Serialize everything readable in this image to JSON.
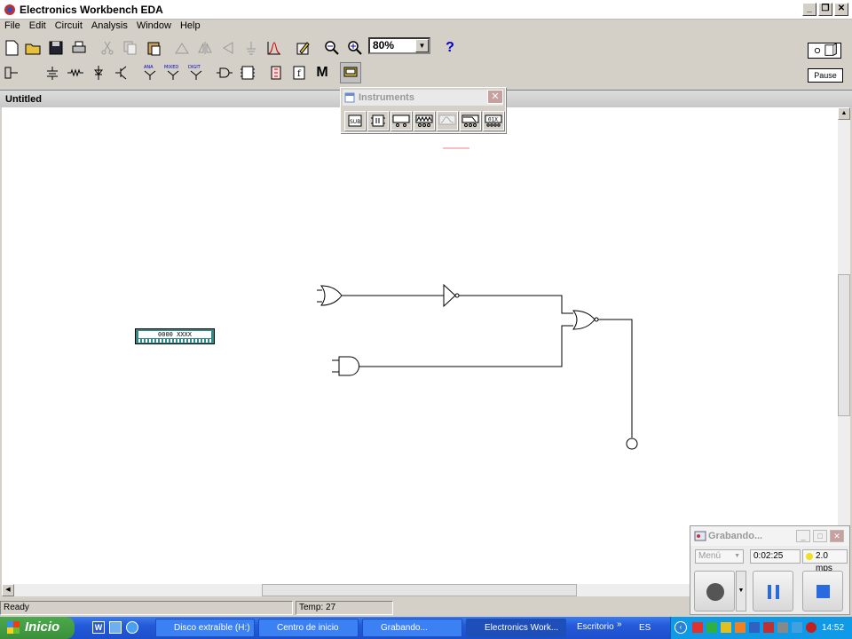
{
  "window": {
    "title": "Electronics Workbench EDA"
  },
  "menu": [
    "File",
    "Edit",
    "Circuit",
    "Analysis",
    "Window",
    "Help"
  ],
  "toolbar": {
    "zoom": "80%",
    "help_label": "?",
    "pause_label": "Pause"
  },
  "parts_bin": {
    "ana_label": "ANA",
    "mixed_label": "MIXED",
    "digit_label": "DIGIT",
    "misc_label": "M"
  },
  "document": {
    "title": "Untitled"
  },
  "instruments": {
    "title": "Instruments",
    "sub_label": "SUB",
    "word_gen_label": "01X"
  },
  "word_generator": {
    "text": "0000 XXXX"
  },
  "status": {
    "ready": "Ready",
    "temp": "Temp:  27"
  },
  "recorder": {
    "title": "Grabando...",
    "menu_label": "Menú",
    "time": "0:02:25",
    "rate": "2.0 mps"
  },
  "taskbar": {
    "start_label": "Inicio",
    "tasks": [
      "Disco extraíble (H:)",
      "Centro de inicio",
      "Grabando...",
      "Electronics Work...",
      "Escritorio"
    ],
    "lang": "ES",
    "clock": "14:52"
  },
  "colors": {
    "accent": "#0a246a",
    "taskbar": "#245edb",
    "wire": "#000000"
  }
}
